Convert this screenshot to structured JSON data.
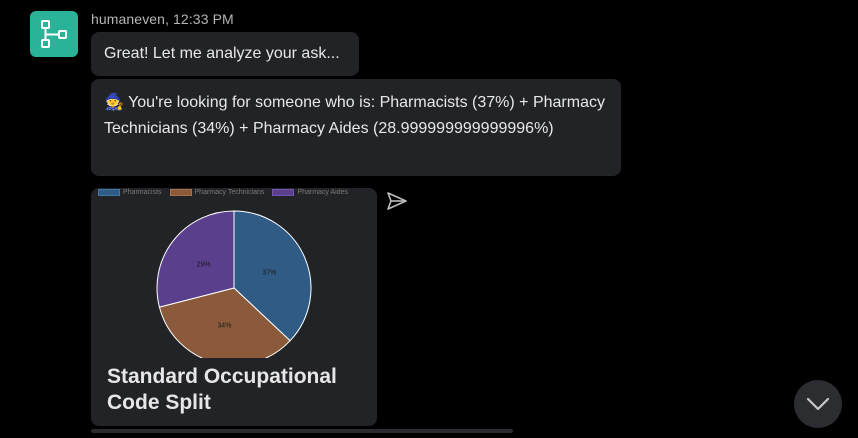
{
  "message": {
    "sender": "humaneven",
    "time": "12:33 PM",
    "header": "humaneven, 12:33 PM",
    "text_1": "Great! Let me analyze your ask...",
    "text_2_emoji": "🧙",
    "text_2": "You're looking for someone who is: Pharmacists (37%) + Pharmacy Technicians (34%) + Pharmacy Aides (28.999999999999996%)"
  },
  "card": {
    "title": "Standard Occupational Code Split"
  },
  "icons": {
    "avatar": "flow-diagram-icon",
    "send": "send-icon",
    "scroll": "chevron-down-icon"
  },
  "colors": {
    "avatar_bg": "#2bb39a",
    "pharmacists": "#2f5b84",
    "technicians": "#8a5a3a",
    "aides": "#5a3f8c"
  },
  "chart_data": {
    "type": "pie",
    "title": "",
    "legend": [
      "Pharmacists",
      "Pharmacy Technicians",
      "Pharmacy Aides"
    ],
    "legend_position": "top",
    "values": [
      37,
      34,
      29
    ],
    "slice_labels": [
      "37%",
      "34%",
      "29%"
    ],
    "colors": [
      "#2f5b84",
      "#8a5a3a",
      "#5a3f8c"
    ]
  }
}
